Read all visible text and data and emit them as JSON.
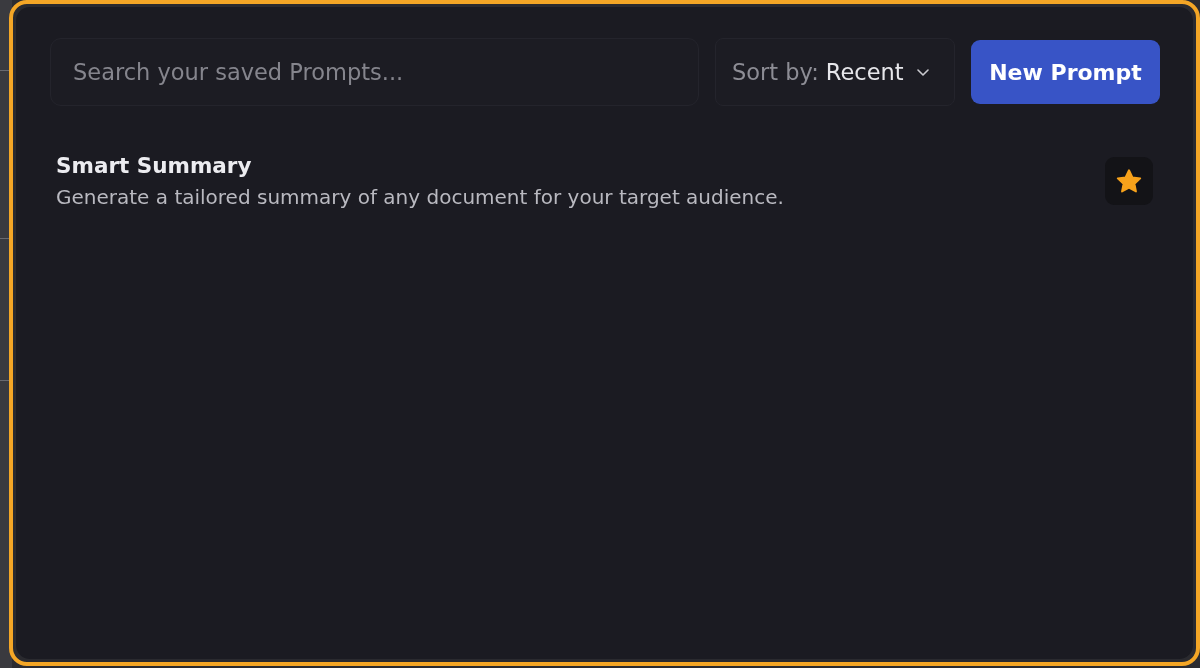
{
  "search": {
    "placeholder": "Search your saved Prompts..."
  },
  "sort": {
    "label": "Sort by:",
    "value": "Recent"
  },
  "new_button": {
    "label": "New Prompt"
  },
  "prompts": [
    {
      "title": "Smart Summary",
      "description": "Generate a tailored summary of any document for your target audience.",
      "starred": true
    }
  ]
}
